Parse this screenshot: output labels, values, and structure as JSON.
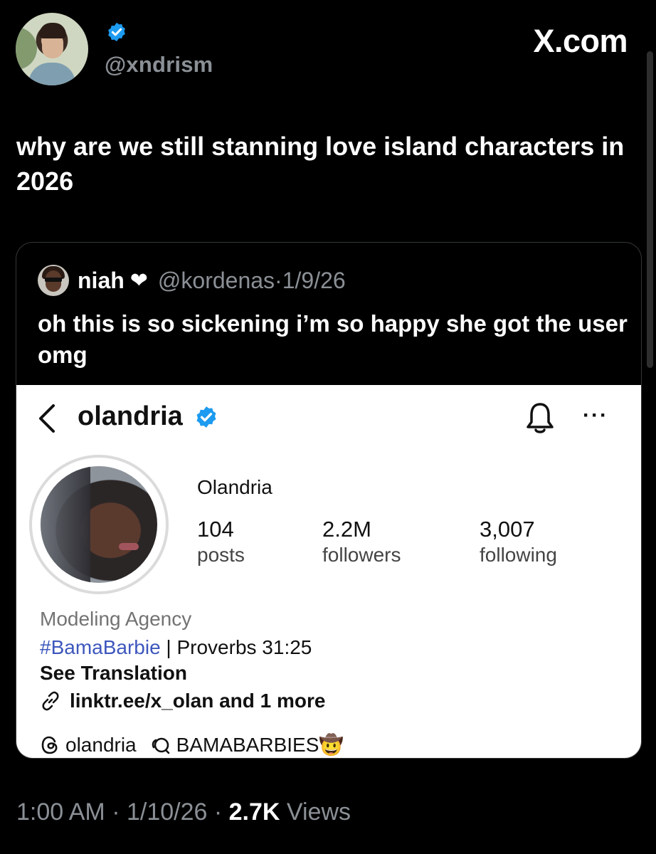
{
  "header": {
    "handle": "@xndrism",
    "brand": "X.com",
    "verified_color": "#1d9bf0"
  },
  "tweet": {
    "text": "why are we still stanning love island characters in 2026",
    "meta": {
      "time": "1:00 AM",
      "sep1": " · ",
      "date": "1/10/26",
      "sep2": " · ",
      "views_count": "2.7K",
      "views_label": " Views"
    }
  },
  "quote": {
    "name": "niah",
    "heart": "❤",
    "handle": "@kordenas",
    "sep": " · ",
    "date": "1/9/26",
    "text": "oh this is so sickening i’m so happy she got the user omg"
  },
  "instagram": {
    "username": "olandria",
    "display_name": "Olandria",
    "stats": [
      {
        "value": "104",
        "label": "posts"
      },
      {
        "value": "2.2M",
        "label": "followers"
      },
      {
        "value": "3,007",
        "label": "following"
      }
    ],
    "category": "Modeling Agency",
    "bio_tag": "#BamaBarbie",
    "bio_rest": " | Proverbs 31:25",
    "see_translation": "See Translation",
    "link_text": "linktr.ee/x_olan and 1 more",
    "threads_handle": "olandria",
    "channel_name": "BAMABARBIES",
    "channel_emoji": "🤠",
    "more_label": "···"
  },
  "icons": [
    "verified-badge-icon",
    "back-chevron-icon",
    "bell-icon",
    "more-icon",
    "link-icon",
    "threads-icon",
    "channel-icon"
  ]
}
